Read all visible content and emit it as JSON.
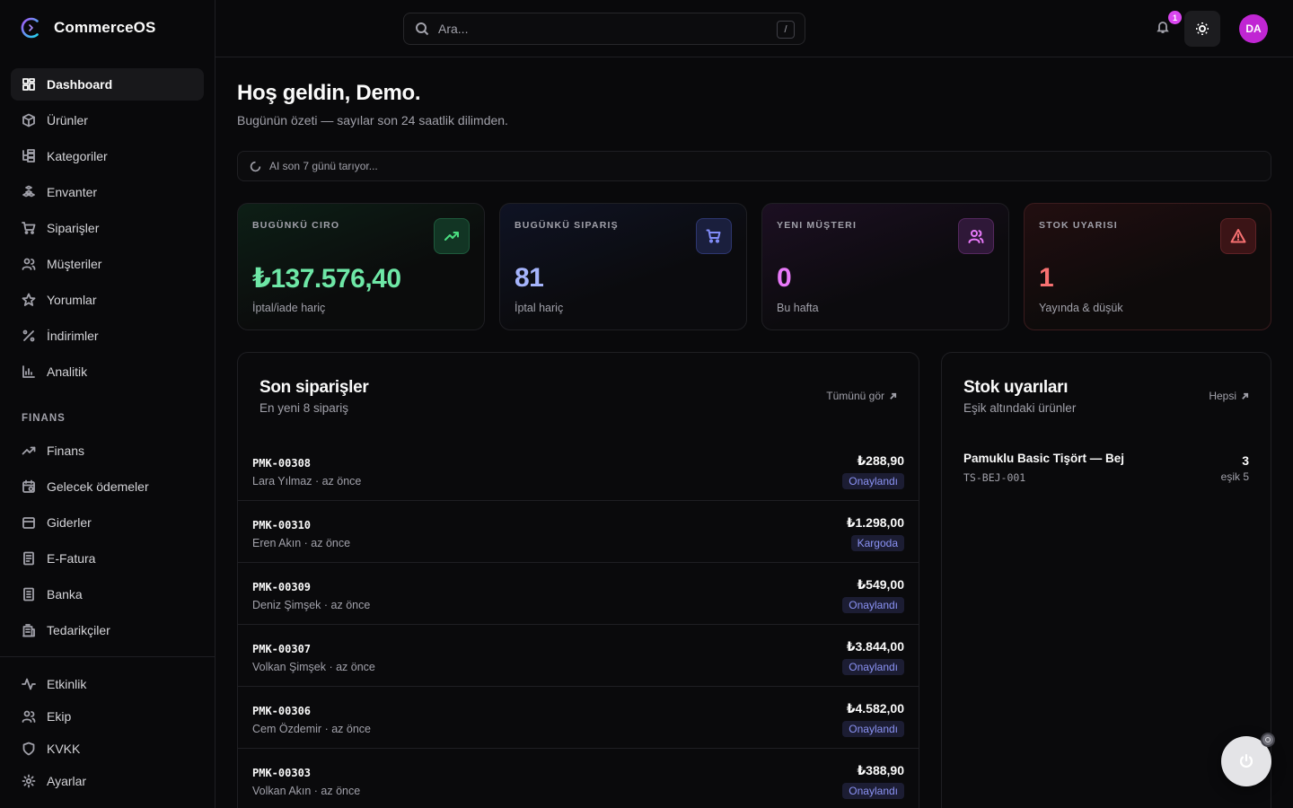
{
  "app": {
    "name": "CommerceOS"
  },
  "sidebar": {
    "main_items": [
      {
        "label": "Dashboard",
        "icon": "dashboard-icon",
        "active": true
      },
      {
        "label": "Ürünler",
        "icon": "package-icon"
      },
      {
        "label": "Kategoriler",
        "icon": "category-tree-icon"
      },
      {
        "label": "Envanter",
        "icon": "boxes-icon"
      },
      {
        "label": "Siparişler",
        "icon": "cart-icon"
      },
      {
        "label": "Müşteriler",
        "icon": "users-icon"
      },
      {
        "label": "Yorumlar",
        "icon": "star-icon"
      },
      {
        "label": "İndirimler",
        "icon": "percent-icon"
      },
      {
        "label": "Analitik",
        "icon": "bar-chart-icon"
      }
    ],
    "section_label": "FINANS",
    "finance_items": [
      {
        "label": "Finans",
        "icon": "trend-icon"
      },
      {
        "label": "Gelecek ödemeler",
        "icon": "calendar-clock-icon"
      },
      {
        "label": "Giderler",
        "icon": "wallet-icon"
      },
      {
        "label": "E-Fatura",
        "icon": "invoice-icon"
      },
      {
        "label": "Banka",
        "icon": "bank-icon"
      },
      {
        "label": "Tedarikçiler",
        "icon": "building-icon"
      }
    ],
    "bottom_items": [
      {
        "label": "Etkinlik",
        "icon": "activity-icon"
      },
      {
        "label": "Ekip",
        "icon": "team-icon"
      },
      {
        "label": "KVKK",
        "icon": "shield-icon"
      },
      {
        "label": "Ayarlar",
        "icon": "gear-icon"
      }
    ]
  },
  "topbar": {
    "search_placeholder": "Ara...",
    "search_shortcut": "/",
    "notification_count": "1",
    "avatar_initials": "DA"
  },
  "main": {
    "welcome": "Hoş geldin, Demo.",
    "subtitle": "Bugünün özeti — sayılar son 24 saatlik dilimden.",
    "ai_status": "AI son 7 günü tarıyor..."
  },
  "kpis": [
    {
      "label": "BUGÜNKÜ CIRO",
      "value": "₺137.576,40",
      "sub": "İptal/iade hariç",
      "icon": "trending-up-icon"
    },
    {
      "label": "BUGÜNKÜ SIPARIŞ",
      "value": "81",
      "sub": "İptal hariç",
      "icon": "cart-icon"
    },
    {
      "label": "YENI MÜŞTERI",
      "value": "0",
      "sub": "Bu hafta",
      "icon": "users-icon"
    },
    {
      "label": "STOK UYARISI",
      "value": "1",
      "sub": "Yayında & düşük",
      "icon": "alert-triangle-icon"
    }
  ],
  "orders_panel": {
    "title": "Son siparişler",
    "subtitle": "En yeni 8 sipariş",
    "link": "Tümünü gör",
    "rows": [
      {
        "id": "PMK-00308",
        "meta": "Lara Yılmaz · az önce",
        "amount": "₺288,90",
        "status": "Onaylandı"
      },
      {
        "id": "PMK-00310",
        "meta": "Eren Akın · az önce",
        "amount": "₺1.298,00",
        "status": "Kargoda"
      },
      {
        "id": "PMK-00309",
        "meta": "Deniz Şimşek · az önce",
        "amount": "₺549,00",
        "status": "Onaylandı"
      },
      {
        "id": "PMK-00307",
        "meta": "Volkan Şimşek · az önce",
        "amount": "₺3.844,00",
        "status": "Onaylandı"
      },
      {
        "id": "PMK-00306",
        "meta": "Cem Özdemir · az önce",
        "amount": "₺4.582,00",
        "status": "Onaylandı"
      },
      {
        "id": "PMK-00303",
        "meta": "Volkan Akın · az önce",
        "amount": "₺388,90",
        "status": "Onaylandı"
      }
    ]
  },
  "stock_panel": {
    "title": "Stok uyarıları",
    "subtitle": "Eşik altındaki ürünler",
    "link": "Hepsi",
    "rows": [
      {
        "name": "Pamuklu Basic Tişört — Bej",
        "sku": "TS-BEJ-001",
        "qty": "3",
        "threshold": "eşik 5"
      }
    ]
  },
  "colors": {
    "accent_green": "#6ee7a6",
    "accent_indigo": "#a5b4fc",
    "accent_fuchsia": "#e879f9",
    "accent_red": "#f87171",
    "status_badge": "#8b93f5"
  }
}
